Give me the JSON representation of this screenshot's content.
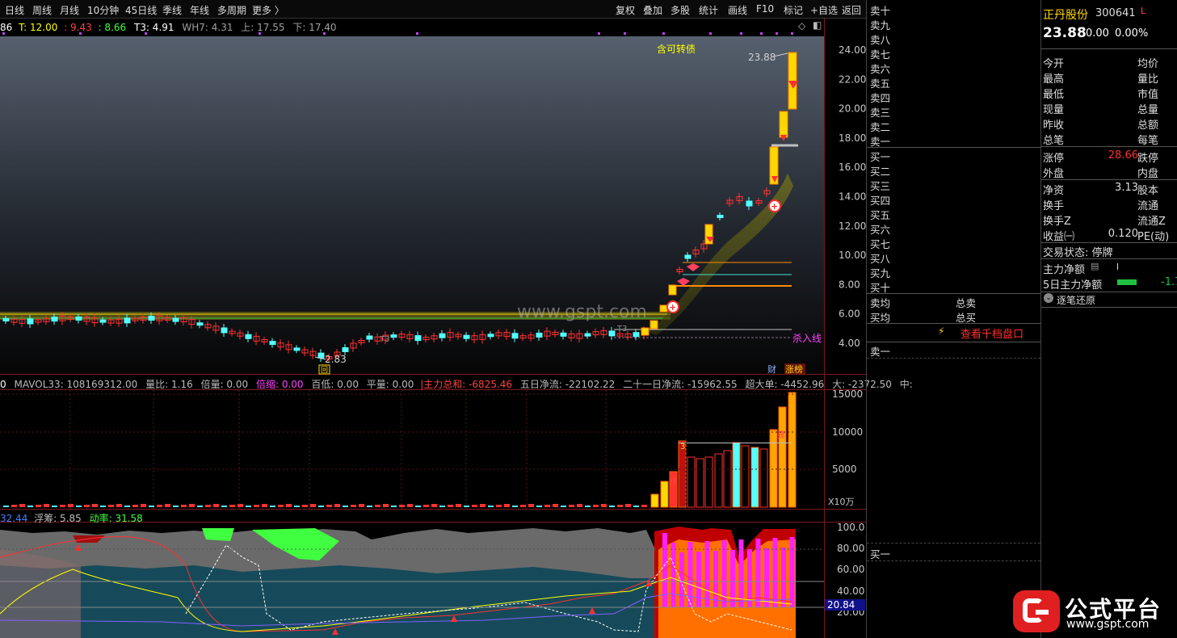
{
  "toolbar": {
    "tabs": [
      "日线",
      "周线",
      "月线",
      "10分钟",
      "45日线",
      "季线",
      "年线",
      "多周期",
      "更多 〉"
    ],
    "actions": [
      "复权",
      "叠加",
      "多股",
      "统计",
      "画线",
      "F10",
      "标记",
      "+自选",
      "返回"
    ]
  },
  "main_legend": [
    {
      "text": "86",
      "color": "#ffffff"
    },
    {
      "text": "T: 12.00",
      "color": "#ffff00"
    },
    {
      "text": ": 9.43",
      "color": "#ff4040"
    },
    {
      "text": ": 8.66",
      "color": "#40ff40"
    },
    {
      "text": "T3: 4.91",
      "color": "#ffffff"
    },
    {
      "text": "WH7: 4.31",
      "color": "#c0c0c0"
    },
    {
      "text": "上: 17.55",
      "color": "#c0c0c0"
    },
    {
      "text": "下: 17.40",
      "color": "#c0c0c0"
    }
  ],
  "main_chart": {
    "y_ticks": [
      "24.00",
      "22.00",
      "20.00",
      "18.00",
      "16.00",
      "14.00",
      "12.00",
      "10.00",
      "8.00",
      "6.00",
      "4.00"
    ],
    "annotation_top": "含可转债",
    "high_label": "23.88",
    "low_label": "2.83",
    "kill_line_label": "杀入线",
    "t3_label": "T3",
    "t3_label_2": "T3",
    "watermark": "www.gspt.com",
    "badge_cai": "财",
    "badge_zhangbang": "涨榜",
    "badge_hui": "回"
  },
  "vol_legend": [
    {
      "text": "0",
      "color": "#ffffff"
    },
    {
      "text": "MAVOL33: 108169312.00",
      "color": "#c0c0c0"
    },
    {
      "text": "量比: 1.16",
      "color": "#c0c0c0"
    },
    {
      "text": "倍量: 0.00",
      "color": "#c0c0c0"
    },
    {
      "text": "倍缩: 0.00",
      "color": "#ff40ff"
    },
    {
      "text": "百低: 0.00",
      "color": "#c0c0c0"
    },
    {
      "text": "平量: 0.00",
      "color": "#c0c0c0"
    },
    {
      "text": "|主力总和: -6825.46",
      "color": "#ff4040"
    },
    {
      "text": "五日净流: -22102.22",
      "color": "#c0c0c0"
    },
    {
      "text": "二十一日净流: -15962.55",
      "color": "#c0c0c0"
    },
    {
      "text": "超大单: -4452.96",
      "color": "#c0c0c0"
    },
    {
      "text": "大: -2372.50",
      "color": "#c0c0c0"
    },
    {
      "text": "中:",
      "color": "#c0c0c0"
    }
  ],
  "vol_chart": {
    "y_ticks": [
      "15000",
      "10000",
      "5000"
    ],
    "unit": "X10万",
    "bar_labels": [
      "3",
      "2",
      "2",
      "建",
      "建"
    ]
  },
  "ind_legend": [
    {
      "text": "32.44",
      "color": "#4080ff"
    },
    {
      "text": "浮筹: 5.85",
      "color": "#c0c0c0"
    },
    {
      "text": "动率: 31.58",
      "color": "#40ff40"
    }
  ],
  "ind_chart": {
    "y_ticks": [
      "100.0",
      "80.00",
      "60.00",
      "40.00",
      "20.00"
    ],
    "current_value": "20.84"
  },
  "stock": {
    "name": "正丹股份",
    "code": "300641",
    "flag": "L",
    "price": "23.88",
    "change": "0.00",
    "change_pct": "0.00%"
  },
  "order_book": {
    "sells": [
      "卖十",
      "卖九",
      "卖八",
      "卖七",
      "卖六",
      "卖五",
      "卖四",
      "卖三",
      "卖二",
      "卖一"
    ],
    "buys": [
      "买一",
      "买二",
      "买三",
      "买四",
      "买五",
      "买六",
      "买七",
      "买八",
      "买九",
      "买十"
    ],
    "avg_sell": "卖均",
    "total_sell": "总卖",
    "avg_buy": "买均",
    "total_buy": "总买",
    "view_all": "查看千档盘口",
    "sell1": "卖一",
    "buy1": "买一"
  },
  "quote_info": {
    "rows1": [
      {
        "k": "今开",
        "v": "",
        "k2": "均价"
      },
      {
        "k": "最高",
        "v": "",
        "k2": "量比"
      },
      {
        "k": "最低",
        "v": "",
        "k2": "市值"
      },
      {
        "k": "现量",
        "v": "",
        "k2": "总量"
      },
      {
        "k": "昨收",
        "v": "",
        "k2": "总额"
      },
      {
        "k": "总笔",
        "v": "",
        "k2": "每笔"
      }
    ],
    "rows2": [
      {
        "k": "涨停",
        "v": "28.66",
        "k2": "跌停"
      },
      {
        "k": "外盘",
        "v": "",
        "k2": "内盘"
      }
    ],
    "rows3": [
      {
        "k": "净资",
        "v": "3.13",
        "k2": "股本"
      },
      {
        "k": "换手",
        "v": "",
        "k2": "流通"
      },
      {
        "k": "换手Z",
        "v": "",
        "k2": "流通Z"
      },
      {
        "k": "收益㈠",
        "v": "0.120",
        "k2": "PE(动)"
      }
    ],
    "status_label": "交易状态: 停牌",
    "main_net": "主力净额",
    "main_net_5d": "5日主力净额",
    "main_net_5d_val": "-1.7",
    "tick_restore": "逐笔还原"
  },
  "brand": {
    "name": "公式平台",
    "url": "www.gspt.com"
  },
  "colors": {
    "up": "#ff3030",
    "down": "#54ffff",
    "yellow": "#ffd700",
    "grid": "#5a1616"
  }
}
